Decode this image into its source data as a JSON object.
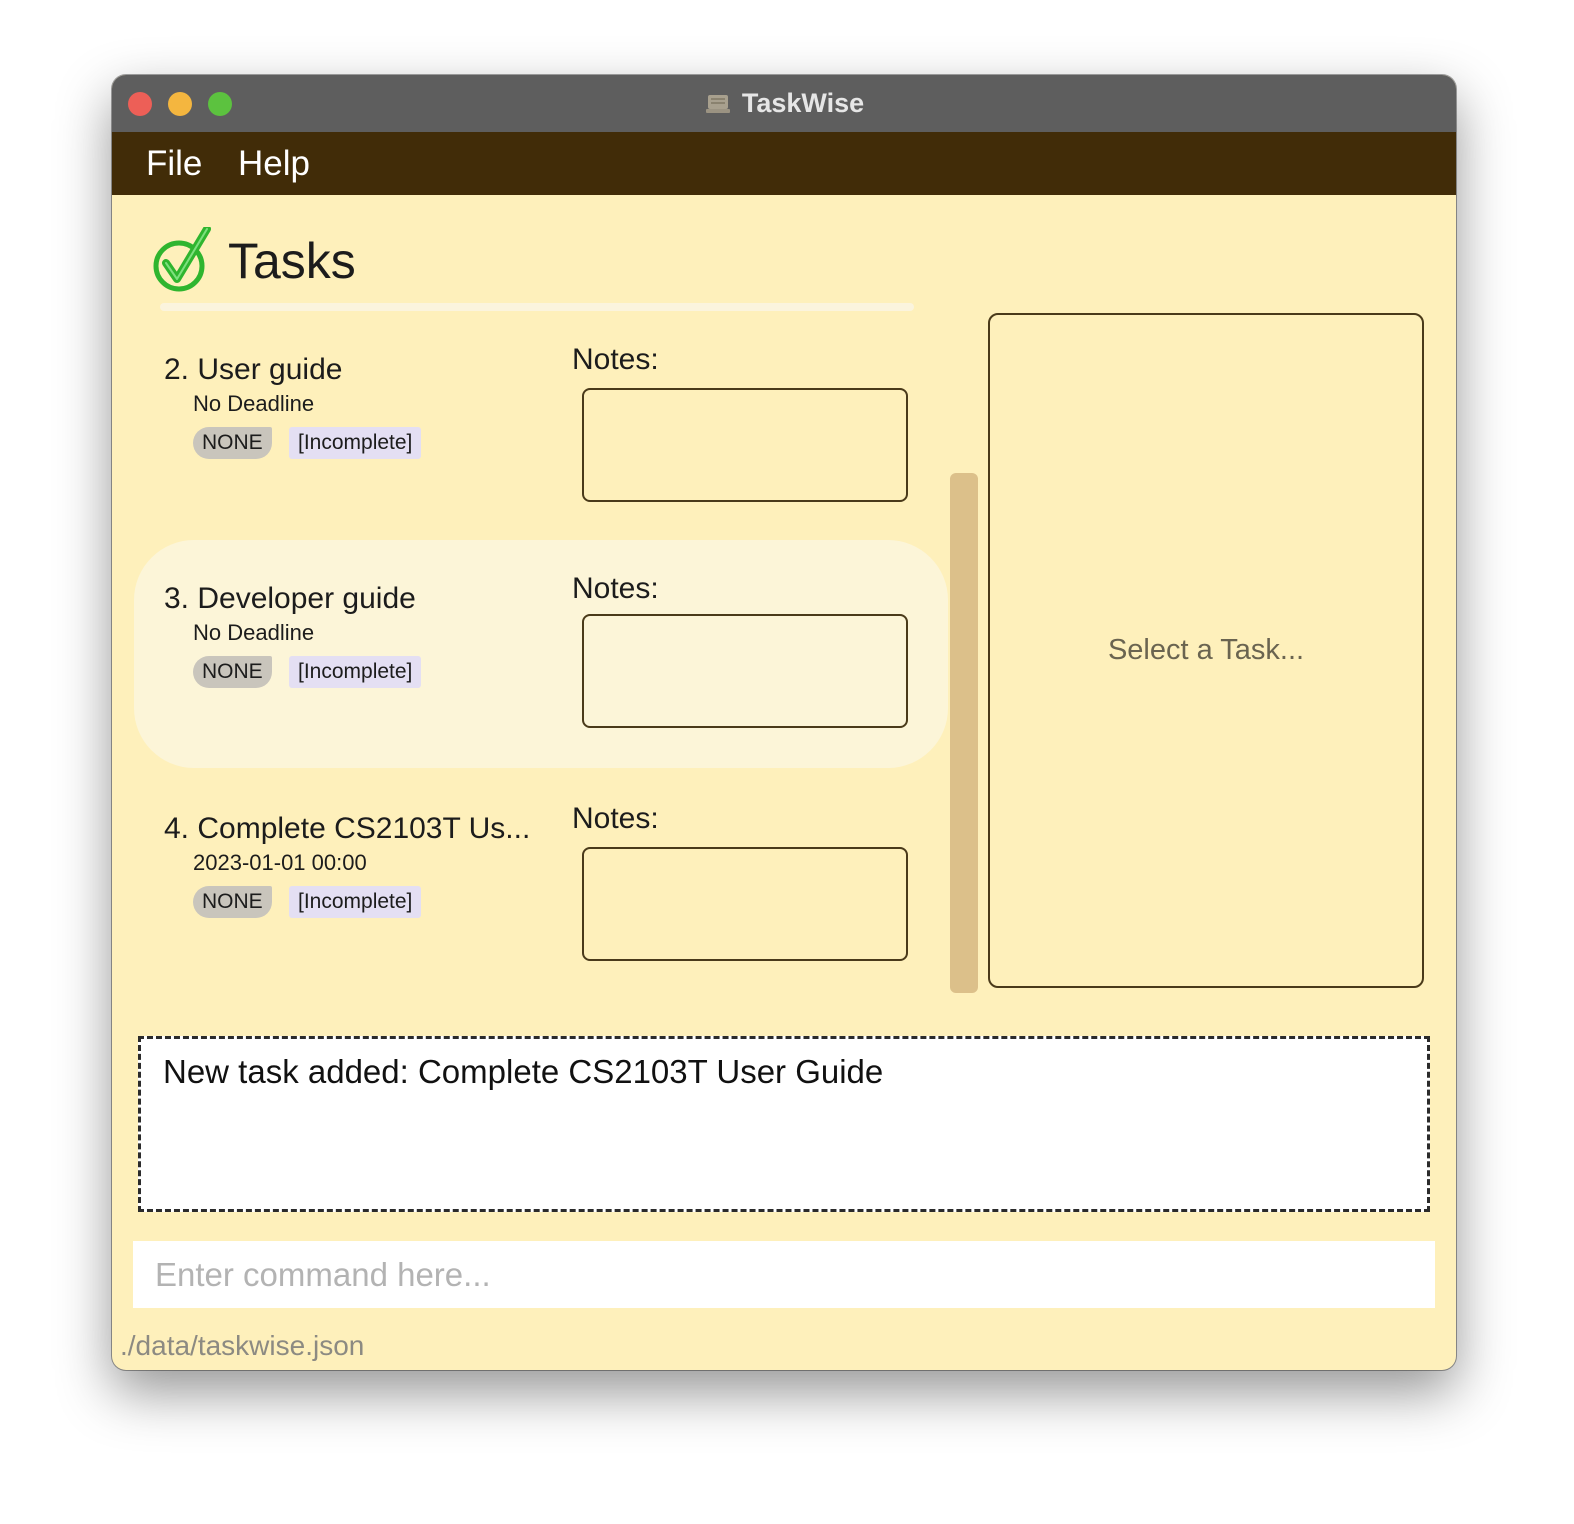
{
  "window": {
    "title": "TaskWise"
  },
  "menu": {
    "file_label": "File",
    "help_label": "Help"
  },
  "tasks_panel": {
    "title": "Tasks",
    "notes_label": "Notes:",
    "items": [
      {
        "name": "2. User guide",
        "deadline": "No Deadline",
        "priority": "NONE",
        "status": "[Incomplete]",
        "notes": "",
        "selected": false
      },
      {
        "name": "3. Developer guide",
        "deadline": "No Deadline",
        "priority": "NONE",
        "status": "[Incomplete]",
        "notes": "",
        "selected": true
      },
      {
        "name": "4. Complete CS2103T Us...",
        "deadline": "2023-01-01 00:00",
        "priority": "NONE",
        "status": "[Incomplete]",
        "notes": "",
        "selected": false
      }
    ]
  },
  "detail_panel": {
    "placeholder": "Select a Task..."
  },
  "result_display": {
    "text": "New task added: Complete CS2103T User Guide"
  },
  "command_box": {
    "value": "",
    "placeholder": "Enter command here..."
  },
  "status_bar": {
    "path": "./data/taskwise.json"
  },
  "colors": {
    "window_bg": "#fef0bb",
    "menubar_bg": "#412c08",
    "titlebar_bg": "#5e5e5e",
    "selected_card_bg": "#fcf5d8",
    "priority_tag_bg": "#c9c5bc",
    "status_tag_bg": "#e4dff3",
    "scrollbar": "#dcc08a"
  },
  "icons": {
    "app": "taskwise-app-icon",
    "tasks_header": "green-check-icon"
  }
}
